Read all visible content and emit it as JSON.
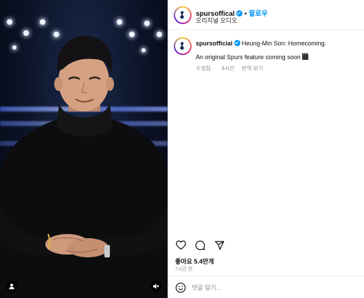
{
  "post": {
    "username": "spursoffical",
    "follow_label": "팔로우",
    "separator": "•",
    "audio_label": "오리지널 오디오",
    "caption_username": "spursofficial",
    "caption_title": "Heung-Min Son: Homecoming.",
    "caption_line2": "An original Spurs feature coming soon",
    "caption_emoji_icon": "clapper-board-icon",
    "edited_label": "수정됨",
    "edited_time": "4시간",
    "translate_label": "번역 보기",
    "likes_text": "좋아요 5.4만개",
    "posted_ago": "7시간 전"
  },
  "comment": {
    "placeholder": "댓글 달기..."
  },
  "icons": {
    "verified": "verified-badge-icon",
    "like": "heart-icon",
    "comment": "comment-icon",
    "share": "paper-plane-icon",
    "emoji": "smiley-icon",
    "user_tag": "user-tag-icon",
    "mute": "speaker-muted-icon"
  },
  "colors": {
    "accent": "#0095f6",
    "muted_text": "#8e8e8e"
  }
}
